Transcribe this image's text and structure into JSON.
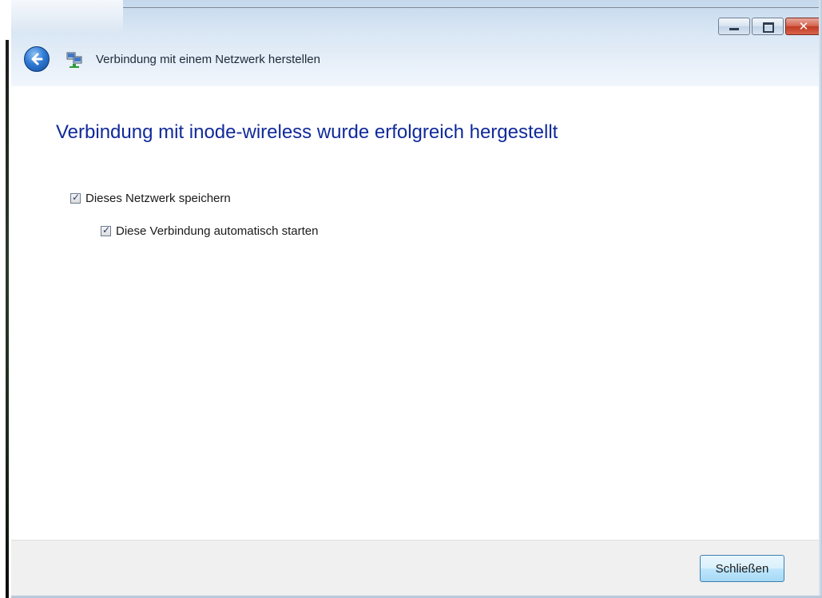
{
  "window": {
    "title": "Verbindung mit einem Netzwerk herstellen",
    "caption_buttons": [
      {
        "name": "minimize",
        "icon": "minimize-icon"
      },
      {
        "name": "maximize",
        "icon": "maximize-icon"
      },
      {
        "name": "close",
        "icon": "close-icon",
        "glyph": "✕"
      }
    ]
  },
  "nav": {
    "back_icon": "back-arrow-icon",
    "app_icon": "network-connection-icon"
  },
  "main": {
    "heading": "Verbindung mit inode-wireless wurde erfolgreich hergestellt",
    "options": [
      {
        "label": "Dieses Netzwerk speichern",
        "checked": true
      },
      {
        "label": "Diese Verbindung automatisch starten",
        "checked": true
      }
    ]
  },
  "footer": {
    "close_label": "Schließen"
  },
  "colors": {
    "heading": "#102a9a",
    "titlebar": "#d8e6f4",
    "footer": "#f0f0f0"
  }
}
